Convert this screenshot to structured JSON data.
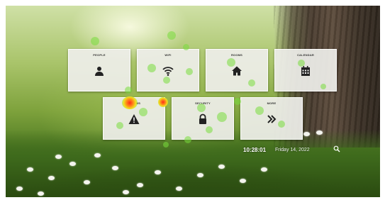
{
  "tiles": {
    "people": {
      "label": "PEOPLE",
      "icon": "person-icon"
    },
    "wifi": {
      "label": "WIFI",
      "icon": "wifi-icon"
    },
    "rooms": {
      "label": "ROOMS",
      "icon": "home-icon"
    },
    "calendar": {
      "label": "CALENDAR",
      "icon": "calendar-icon"
    },
    "alarms": {
      "label": "ALARMS",
      "icon": "warning-icon"
    },
    "security": {
      "label": "SECURITY",
      "icon": "lock-icon"
    },
    "more": {
      "label": "MORE",
      "icon": "double-chevron-right-icon"
    }
  },
  "status": {
    "time": "10:28:01",
    "date": "Friday 14, 2022"
  },
  "search": {
    "icon": "search-icon"
  },
  "colors": {
    "tile_bg": "#eeeeea",
    "icon": "#222222",
    "gaze_green": "#78dc3c",
    "gaze_hot": "#ff2a1a"
  }
}
